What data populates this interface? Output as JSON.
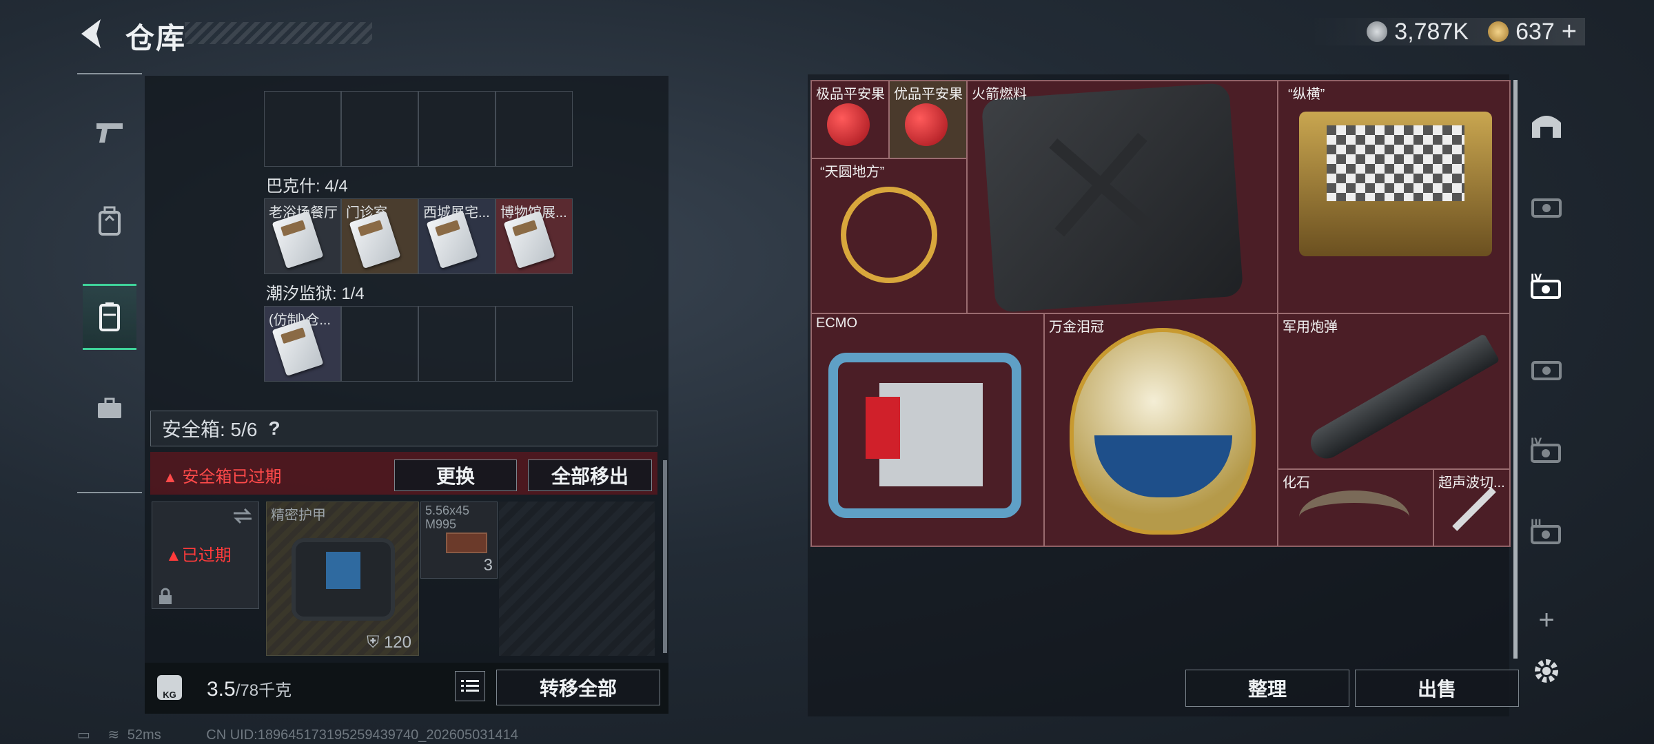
{
  "header": {
    "title": "仓库",
    "currency": [
      {
        "icon": "silver-coin-icon",
        "value": "3,787K"
      },
      {
        "icon": "gold-coin-icon",
        "value": "637"
      }
    ],
    "currency_add": "+"
  },
  "left_rail": [
    "pistol-icon",
    "backpack-icon",
    "container-icon",
    "briefcase-icon"
  ],
  "left_panel": {
    "groups": [
      {
        "label": "巴克什: 4/4",
        "items": [
          "老浴场餐厅",
          "门诊室",
          "西城展宅...",
          "博物馆展..."
        ]
      },
      {
        "label": "潮汐监狱: 1/4",
        "items": [
          "(仿制)仓..."
        ]
      }
    ],
    "safe_box": {
      "label": "安全箱: 5/6",
      "help": "?"
    },
    "expired_notice": "安全箱已过期",
    "swap_button": "更换",
    "move_all_button": "全部移出",
    "expired_badge": "已过期",
    "armor": {
      "name": "精密护甲",
      "durability": "120"
    },
    "ammo": {
      "name": "5.56x45 M995",
      "count": "3"
    },
    "weight": {
      "current": "3.5",
      "max": "/78千克",
      "kg_badge": "KG"
    },
    "transfer_all_button": "转移全部"
  },
  "storage": {
    "items": [
      {
        "name": "极品平安果"
      },
      {
        "name": "优品平安果"
      },
      {
        "name": "火箭燃料"
      },
      {
        "name": "“纵横”"
      },
      {
        "name": "“天圆地方”"
      },
      {
        "name": "ECMO"
      },
      {
        "name": "万金泪冠"
      },
      {
        "name": "军用炮弹"
      },
      {
        "name": "化石"
      },
      {
        "name": "超声波切..."
      }
    ],
    "sort_button": "整理",
    "sell_button": "出售"
  },
  "right_rail": {
    "tabs": [
      "warehouse-icon",
      "storage-tab-1-icon",
      "storage-tab-IV-icon",
      "storage-tab-3-icon",
      "storage-tab-IV-2-icon",
      "storage-tab-III-icon"
    ],
    "add": "+"
  },
  "status_bar": {
    "ping": "52ms",
    "uid": "CN UID:1896451731952594​39740_202605031414"
  }
}
